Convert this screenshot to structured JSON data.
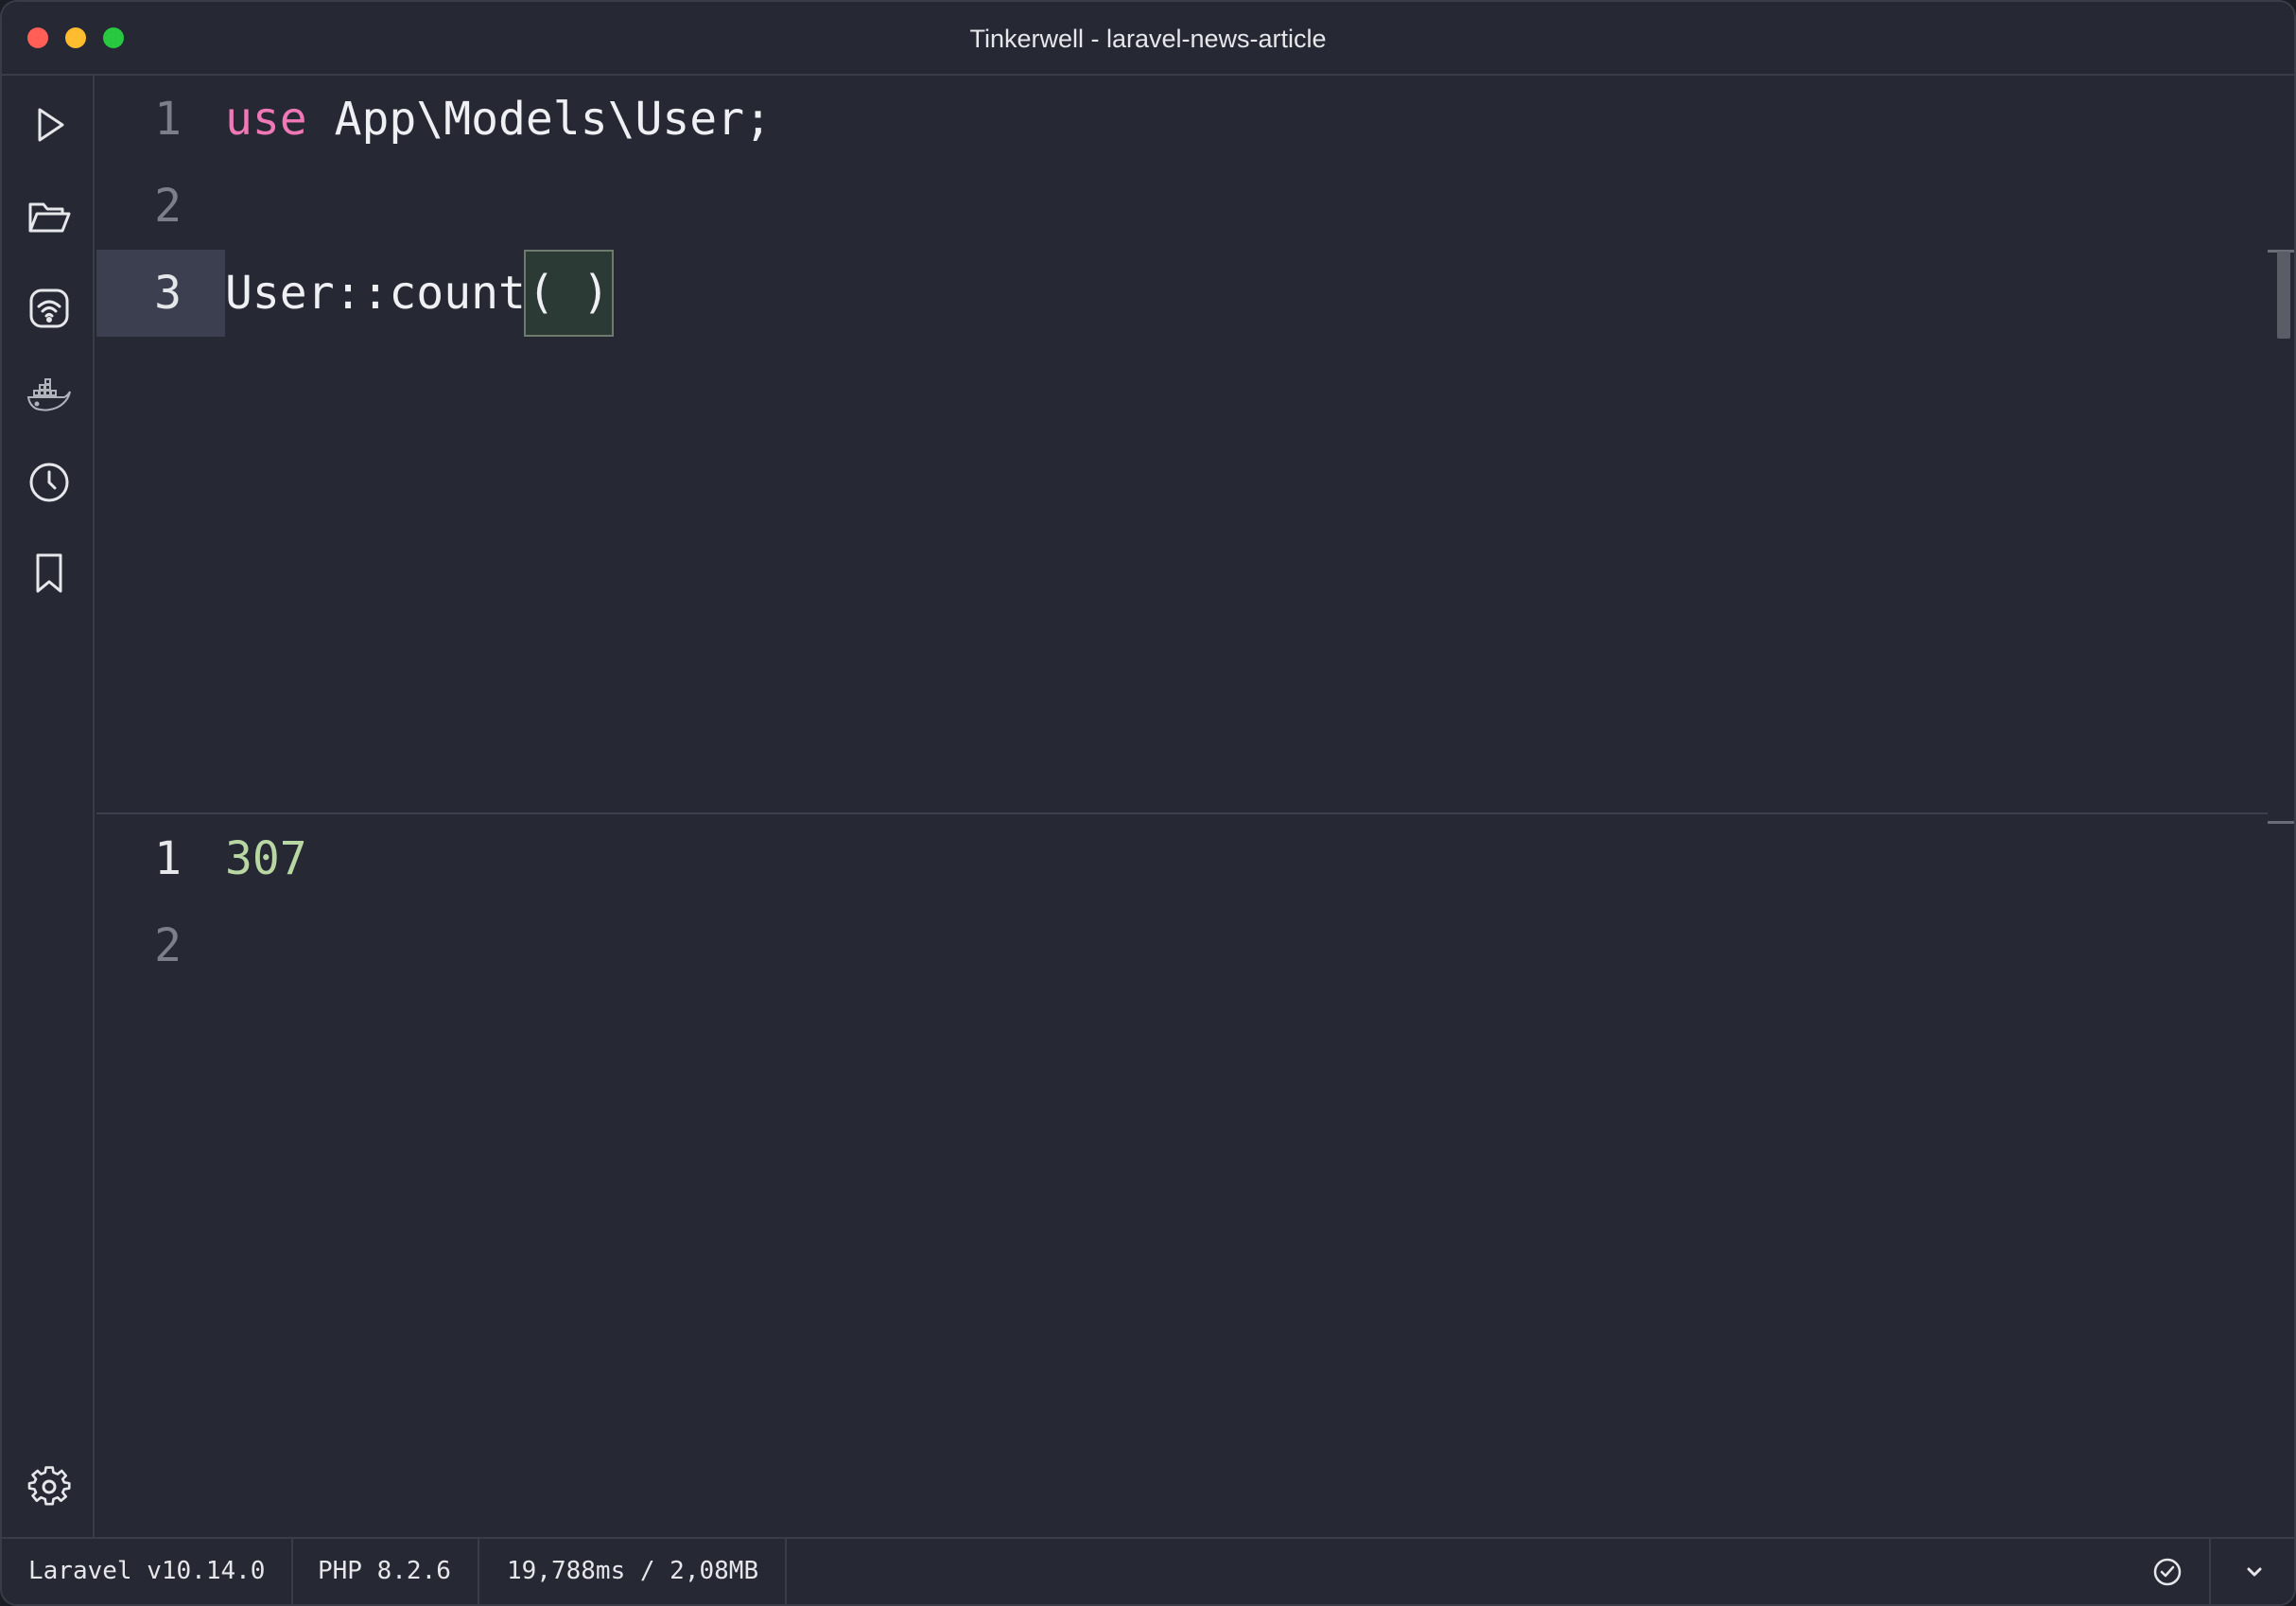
{
  "window": {
    "title": "Tinkerwell - laravel-news-article"
  },
  "sidebar": {
    "items": [
      {
        "name": "run",
        "icon": "play-icon"
      },
      {
        "name": "open",
        "icon": "folder-open-icon"
      },
      {
        "name": "remote",
        "icon": "wifi-shield-icon"
      },
      {
        "name": "docker",
        "icon": "docker-icon"
      },
      {
        "name": "history",
        "icon": "clock-icon"
      },
      {
        "name": "snippets",
        "icon": "bookmark-icon"
      }
    ],
    "settings_icon": "gear-icon"
  },
  "editor": {
    "lines": [
      {
        "num": "1",
        "keyword": "use",
        "rest": " App\\Models\\User;"
      },
      {
        "num": "2",
        "text": ""
      },
      {
        "num": "3",
        "text": "User::count",
        "paren": "( )"
      }
    ],
    "active_line": 3
  },
  "output": {
    "lines": [
      {
        "num": "1",
        "text": "307"
      },
      {
        "num": "2",
        "text": ""
      }
    ]
  },
  "status": {
    "framework": "Laravel v10.14.0",
    "php": "PHP 8.2.6",
    "timing": "19,788ms / 2,08MB",
    "status_icon": "check-circle-icon",
    "menu_icon": "chevron-down-icon"
  },
  "colors": {
    "background": "#262934",
    "keyword": "#f178b6",
    "output_number": "#b8d7a3",
    "active_line": "#3c3f4f"
  }
}
